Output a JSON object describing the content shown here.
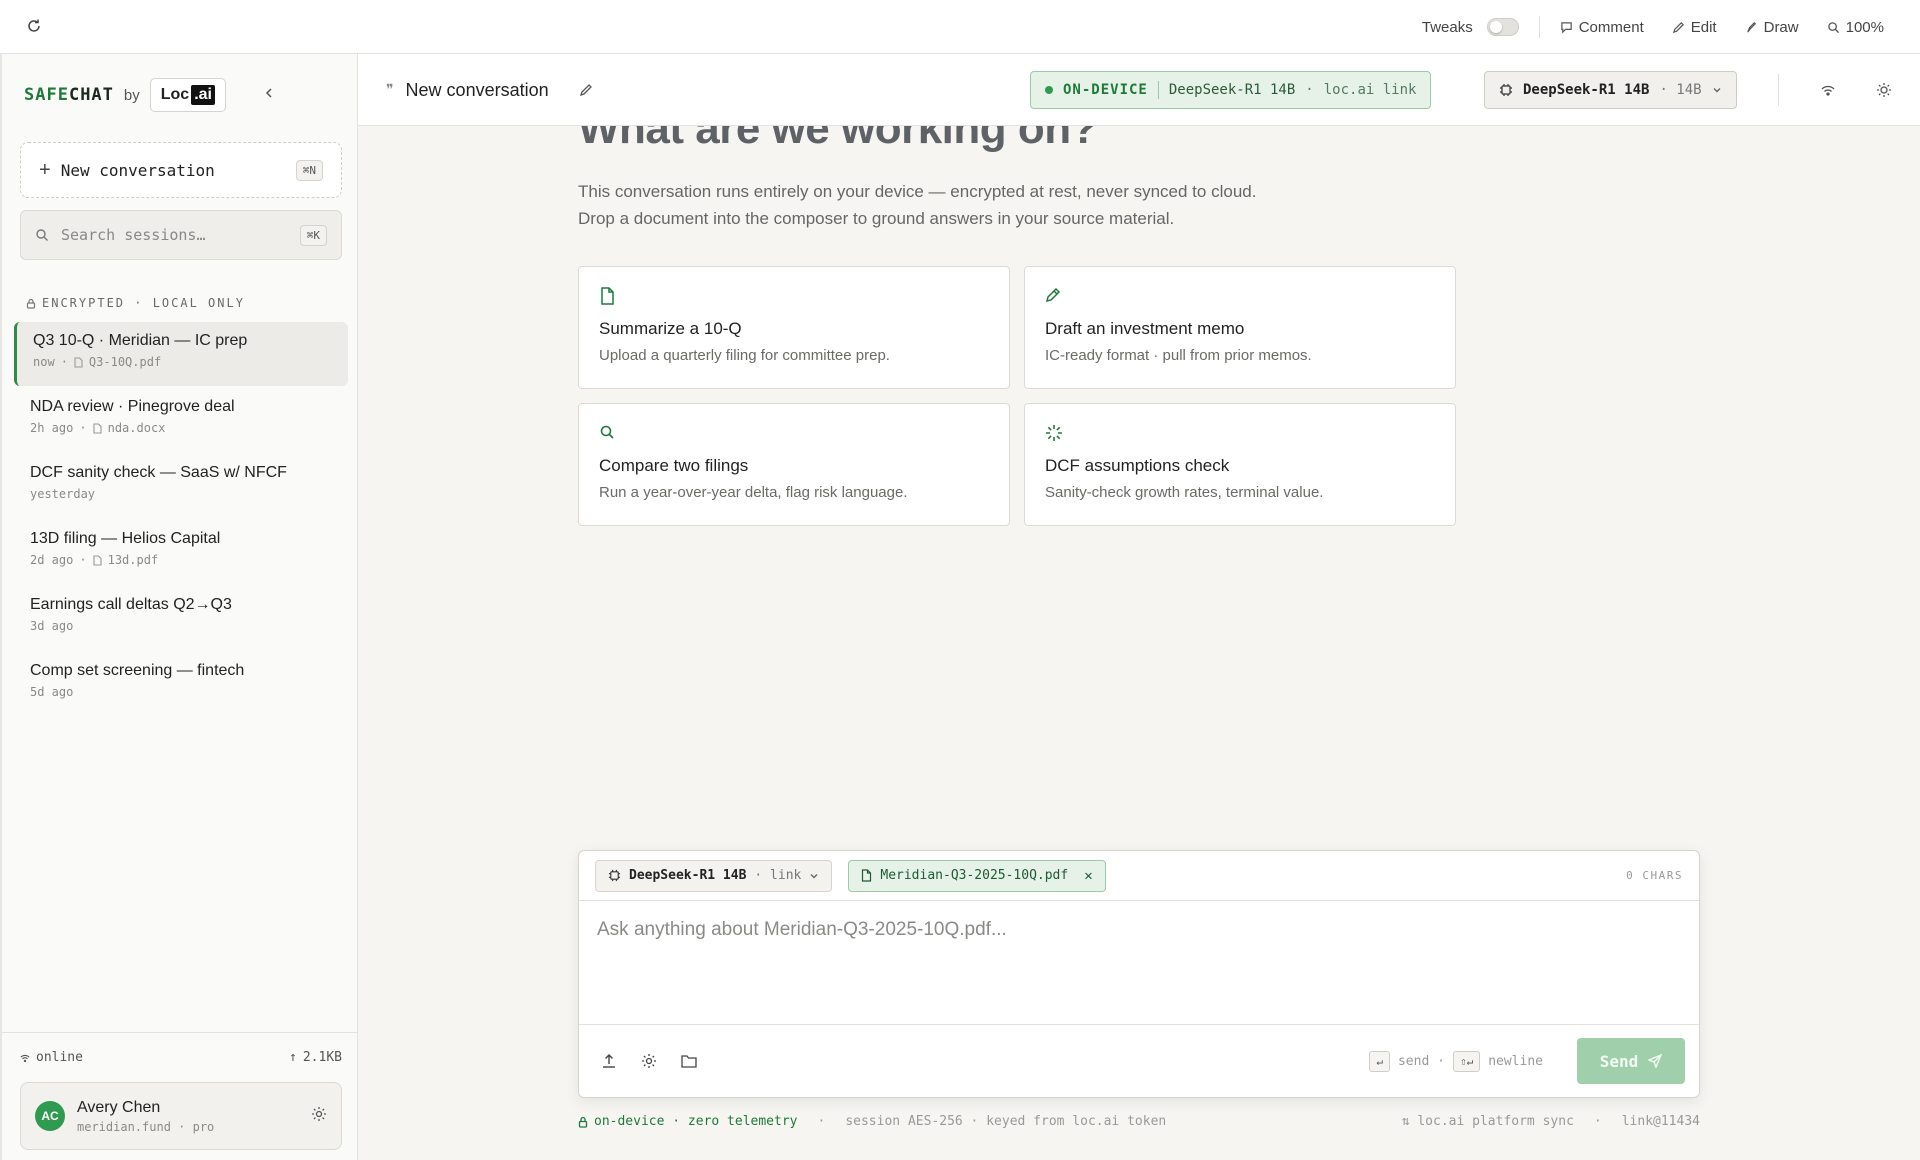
{
  "topbar": {
    "tweaks": "Tweaks",
    "comment": "Comment",
    "edit": "Edit",
    "draw": "Draw",
    "zoom": "100%"
  },
  "sidebar": {
    "brand_safe": "SAFE",
    "brand_chat": "CHAT",
    "brand_by": "by",
    "logo_loc": "Loc",
    "logo_ai": ".ai",
    "new_conversation": "New conversation",
    "new_conversation_kbd": "⌘N",
    "search_placeholder": "Search sessions…",
    "search_kbd": "⌘K",
    "section_label": "ENCRYPTED · LOCAL ONLY",
    "sessions": [
      {
        "title": "Q3 10-Q · Meridian — IC prep",
        "time": "now",
        "file": "Q3-10Q.pdf",
        "active": true
      },
      {
        "title": "NDA review · Pinegrove deal",
        "time": "2h ago",
        "file": "nda.docx",
        "active": false
      },
      {
        "title": "DCF sanity check — SaaS w/ NFCF",
        "time": "yesterday",
        "file": "",
        "active": false
      },
      {
        "title": "13D filing — Helios Capital",
        "time": "2d ago",
        "file": "13d.pdf",
        "active": false
      },
      {
        "title": "Earnings call deltas Q2→Q3",
        "time": "3d ago",
        "file": "",
        "active": false
      },
      {
        "title": "Comp set screening — fintech",
        "time": "5d ago",
        "file": "",
        "active": false
      }
    ],
    "status": "online",
    "upload_size": "2.1KB",
    "user": {
      "initials": "AC",
      "name": "Avery Chen",
      "sub": "meridian.fund · pro"
    }
  },
  "header": {
    "title": "New conversation",
    "ondevice_label": "ON-DEVICE",
    "ondevice_model": "DeepSeek-R1 14B",
    "ondevice_sep": "·",
    "ondevice_link": "loc.ai link",
    "model_name": "DeepSeek-R1 14B",
    "model_size": "· 14B"
  },
  "main": {
    "hero": "What are we working on?",
    "sub_line1": "This conversation runs entirely on your device — encrypted at rest, never synced to cloud.",
    "sub_line2": "Drop a document into the composer to ground answers in your source material.",
    "cards": [
      {
        "title": "Summarize a 10-Q",
        "desc": "Upload a quarterly filing for committee prep.",
        "icon": "document-icon"
      },
      {
        "title": "Draft an investment memo",
        "desc": "IC-ready format · pull from prior memos.",
        "icon": "pencil-icon"
      },
      {
        "title": "Compare two filings",
        "desc": "Run a year-over-year delta, flag risk language.",
        "icon": "search-icon"
      },
      {
        "title": "DCF assumptions check",
        "desc": "Sanity-check growth rates, terminal value.",
        "icon": "sparkle-icon"
      }
    ]
  },
  "composer": {
    "model_name": "DeepSeek-R1 14B",
    "model_mode": "· link",
    "file": "Meridian-Q3-2025-10Q.pdf",
    "chars": "0 CHARS",
    "placeholder": "Ask anything about Meridian-Q3-2025-10Q.pdf...",
    "send_key": "↵",
    "send_hint": "send ·",
    "newline_key": "⇧↵",
    "newline_hint": "newline",
    "send_label": "Send"
  },
  "footer": {
    "left_green": "on-device · zero telemetry",
    "left_sep": "·",
    "session": "session AES-256 · keyed from loc.ai token",
    "sync": "⇅ loc.ai platform sync",
    "sync_sep": "·",
    "link": "link@11434"
  },
  "colors": {
    "accent": "#1f7a3a",
    "accent_light": "#e6f2e8",
    "send_disabled": "#9fd0ab"
  }
}
